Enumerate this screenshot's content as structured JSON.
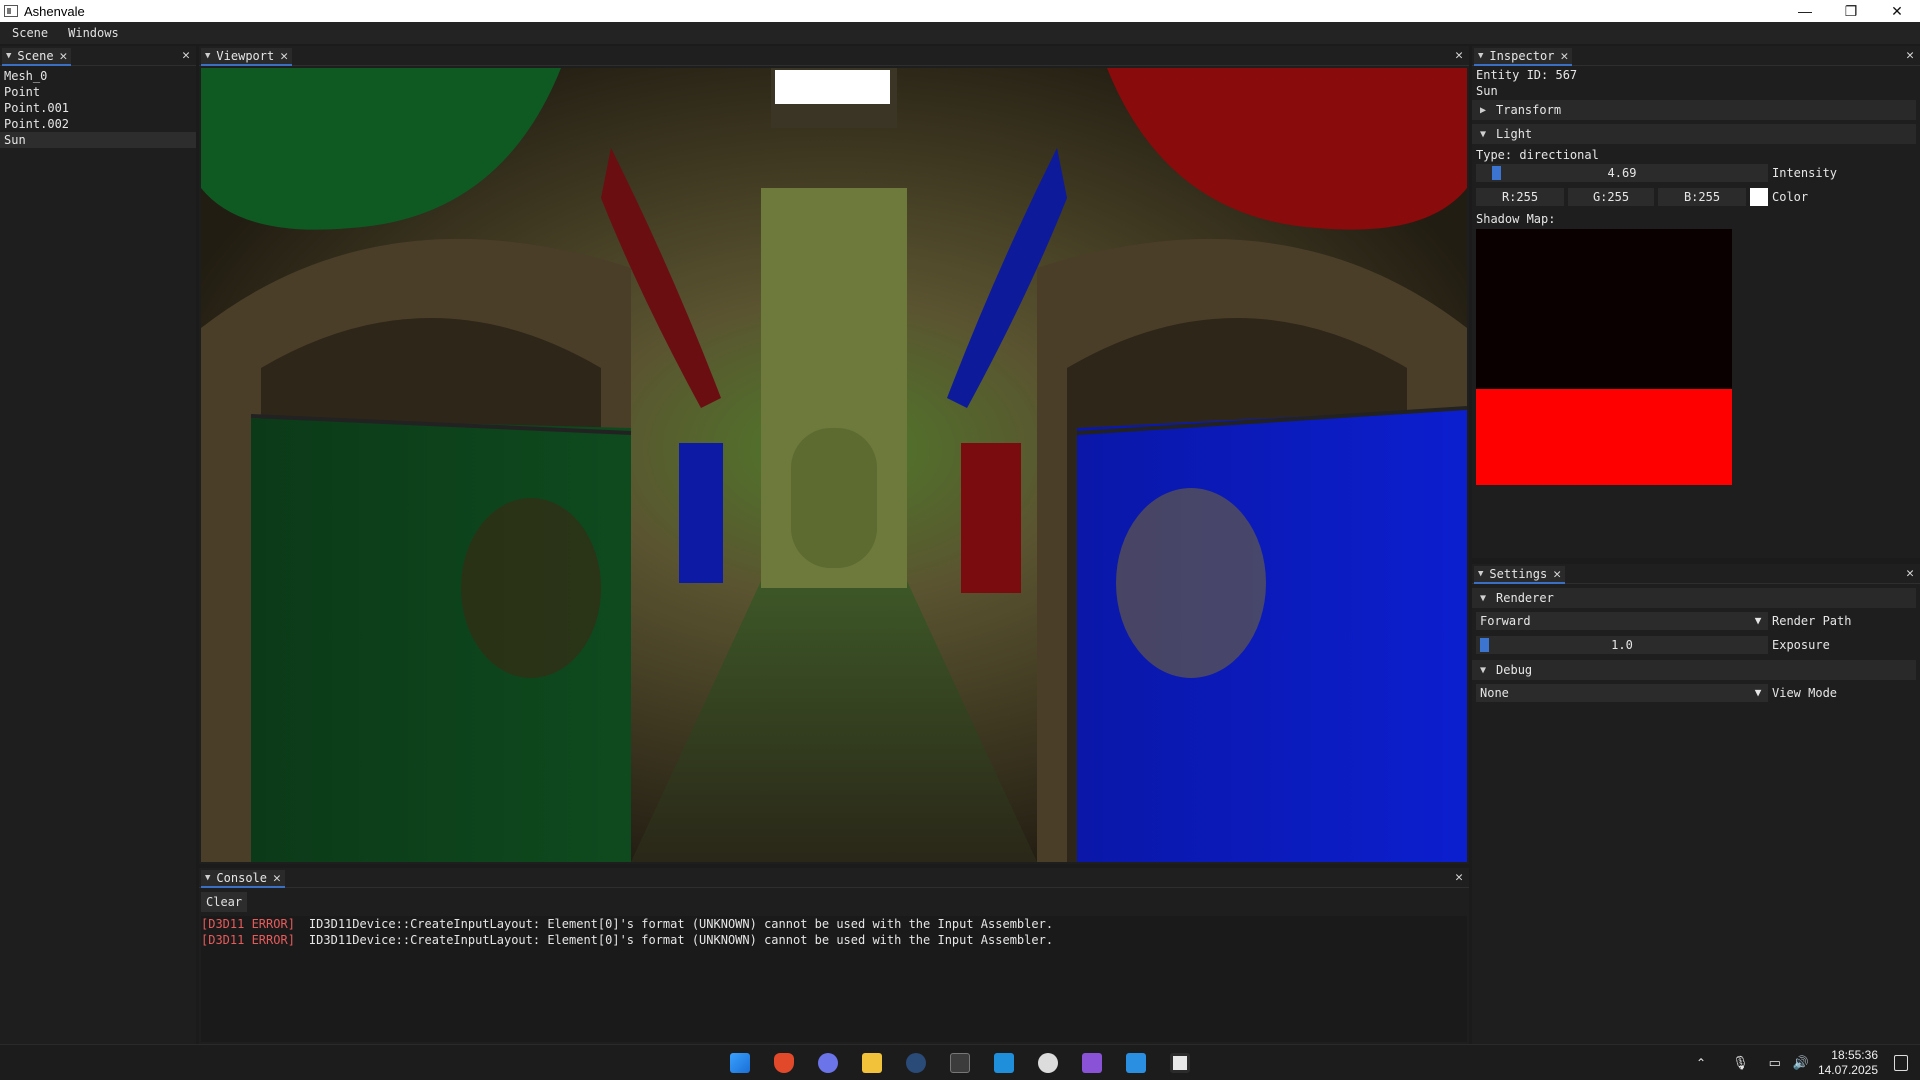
{
  "window": {
    "title": "Ashenvale",
    "controls": {
      "minimize": "—",
      "restore": "❐",
      "close": "✕"
    }
  },
  "menu": [
    "Scene",
    "Windows"
  ],
  "scene_panel": {
    "tab": "Scene",
    "items": [
      "Mesh_0",
      "Point",
      "Point.001",
      "Point.002",
      "Sun"
    ],
    "selected": "Sun"
  },
  "viewport": {
    "tab": "Viewport"
  },
  "inspector": {
    "tab": "Inspector",
    "entity_id": "Entity ID: 567",
    "entity_name": "Sun",
    "transform_header": "Transform",
    "light_header": "Light",
    "light_type": "Type: directional",
    "intensity_value": "4.69",
    "intensity_label": "Intensity",
    "color": {
      "r": "R:255",
      "g": "G:255",
      "b": "B:255",
      "label": "Color",
      "swatch": "#ffffff"
    },
    "shadow_map_label": "Shadow Map:"
  },
  "settings": {
    "tab": "Settings",
    "renderer_header": "Renderer",
    "render_path_value": "Forward",
    "render_path_label": "Render Path",
    "exposure_value": "1.0",
    "exposure_label": "Exposure",
    "debug_header": "Debug",
    "view_mode_value": "None",
    "view_mode_label": "View Mode"
  },
  "console": {
    "tab": "Console",
    "clear_label": "Clear",
    "lines": [
      {
        "tag": "[D3D11 ERROR]",
        "msg": "ID3D11Device::CreateInputLayout: Element[0]'s format (UNKNOWN) cannot be used with the Input Assembler."
      },
      {
        "tag": "[D3D11 ERROR]",
        "msg": "ID3D11Device::CreateInputLayout: Element[0]'s format (UNKNOWN) cannot be used with the Input Assembler."
      }
    ]
  },
  "taskbar": {
    "apps": [
      "start-icon",
      "brave-icon",
      "discord-icon",
      "file-explorer-icon",
      "steam-icon",
      "terminal-icon",
      "vscode-icon",
      "chrome-icon",
      "visual-studio-icon",
      "paint-icon",
      "ashenvale-app-icon"
    ],
    "time": "18:55:36",
    "date": "14.07.2025"
  },
  "colors": {
    "accent": "#3b74d1",
    "error": "#e85b5b",
    "shadow_red": "#ff0000"
  }
}
